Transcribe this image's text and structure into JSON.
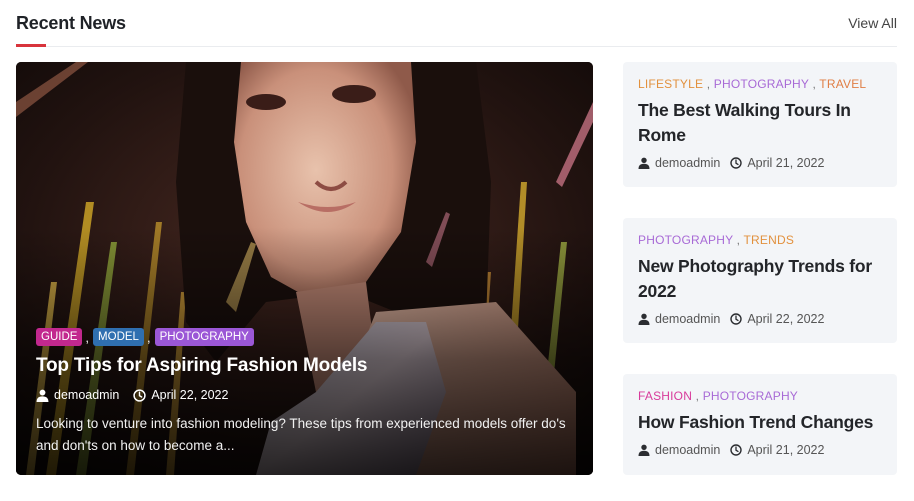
{
  "section": {
    "title": "Recent News",
    "view_all": "View All"
  },
  "featured": {
    "tags": [
      {
        "label": "GUIDE",
        "color": "#c2288e"
      },
      {
        "label": "MODEL",
        "color": "#2f6fb0"
      },
      {
        "label": "PHOTOGRAPHY",
        "color": "#9b57d6"
      }
    ],
    "tag_separator": ",",
    "title": "Top Tips for Aspiring Fashion Models",
    "author": "demoadmin",
    "date": "April 22, 2022",
    "excerpt": "Looking to venture into fashion modeling? These tips from experienced models offer do's and don'ts on how to become a...",
    "image_icon": "portrait-photo"
  },
  "posts": [
    {
      "categories": [
        "LIFESTYLE",
        "PHOTOGRAPHY",
        "TRAVEL"
      ],
      "title": "The Best Walking Tours In Rome",
      "author": "demoadmin",
      "date": "April 21, 2022"
    },
    {
      "categories": [
        "PHOTOGRAPHY",
        "TRENDS"
      ],
      "title": "New Photography Trends for 2022",
      "author": "demoadmin",
      "date": "April 22, 2022"
    },
    {
      "categories": [
        "FASHION",
        "PHOTOGRAPHY"
      ],
      "title": "How Fashion Trend Changes",
      "author": "demoadmin",
      "date": "April 21, 2022"
    }
  ],
  "icons": {
    "author": "user-icon",
    "date": "clock-icon"
  },
  "colors": {
    "accent": "#d8343c",
    "card_bg": "#f3f5f8"
  }
}
